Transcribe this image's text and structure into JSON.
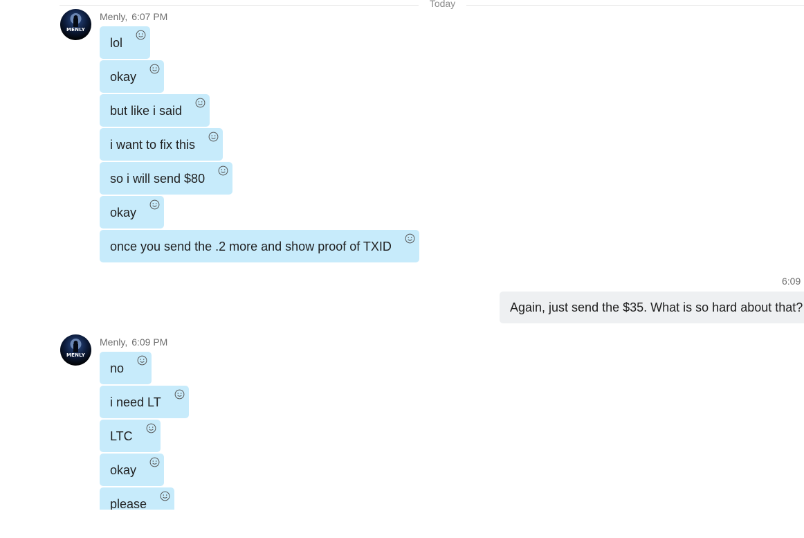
{
  "divider": {
    "label": "Today"
  },
  "groups": [
    {
      "sender": "Menly",
      "time": "6:07 PM",
      "avatar_text": "MENLY",
      "messages": [
        "lol",
        "okay",
        "but like i said",
        "i want to fix this",
        "so i will send $80",
        "okay",
        "once you send the .2 more and show proof of TXID"
      ]
    },
    {
      "sender": "Menly",
      "time": "6:09 PM",
      "avatar_text": "MENLY",
      "messages": [
        "no",
        "i need LT",
        "LTC",
        "okay",
        "please"
      ]
    }
  ],
  "outgoing": {
    "time": "6:09",
    "text": "Again, just send the $35. What is so hard about that?"
  },
  "icons": {
    "reaction": "smiley-face-icon",
    "avatar": "menly-avatar-icon"
  },
  "colors": {
    "incoming_bubble": "#c7ebfb",
    "outgoing_bubble": "#eef0f2",
    "meta_text": "#6e6e6e",
    "divider": "#e3e3e3"
  }
}
